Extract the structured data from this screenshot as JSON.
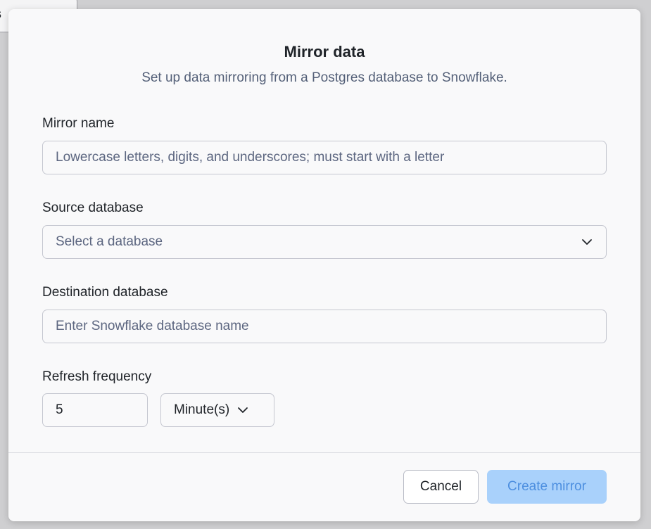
{
  "background": {
    "fragment_text": "s"
  },
  "modal": {
    "title": "Mirror data",
    "subtitle": "Set up data mirroring from a Postgres database to Snowflake."
  },
  "fields": {
    "mirror_name": {
      "label": "Mirror name",
      "value": "",
      "placeholder": "Lowercase letters, digits, and underscores; must start with a letter"
    },
    "source_database": {
      "label": "Source database",
      "placeholder": "Select a database",
      "icon": "chevron-down-icon"
    },
    "destination_database": {
      "label": "Destination database",
      "value": "",
      "placeholder": "Enter Snowflake database name"
    },
    "refresh_frequency": {
      "label": "Refresh frequency",
      "value": "5",
      "unit": "Minute(s)",
      "icon": "chevron-down-icon"
    }
  },
  "footer": {
    "cancel_label": "Cancel",
    "create_label": "Create mirror"
  },
  "colors": {
    "primary_disabled_bg": "#a9d1fb",
    "primary_disabled_text": "#4d8fe0"
  }
}
